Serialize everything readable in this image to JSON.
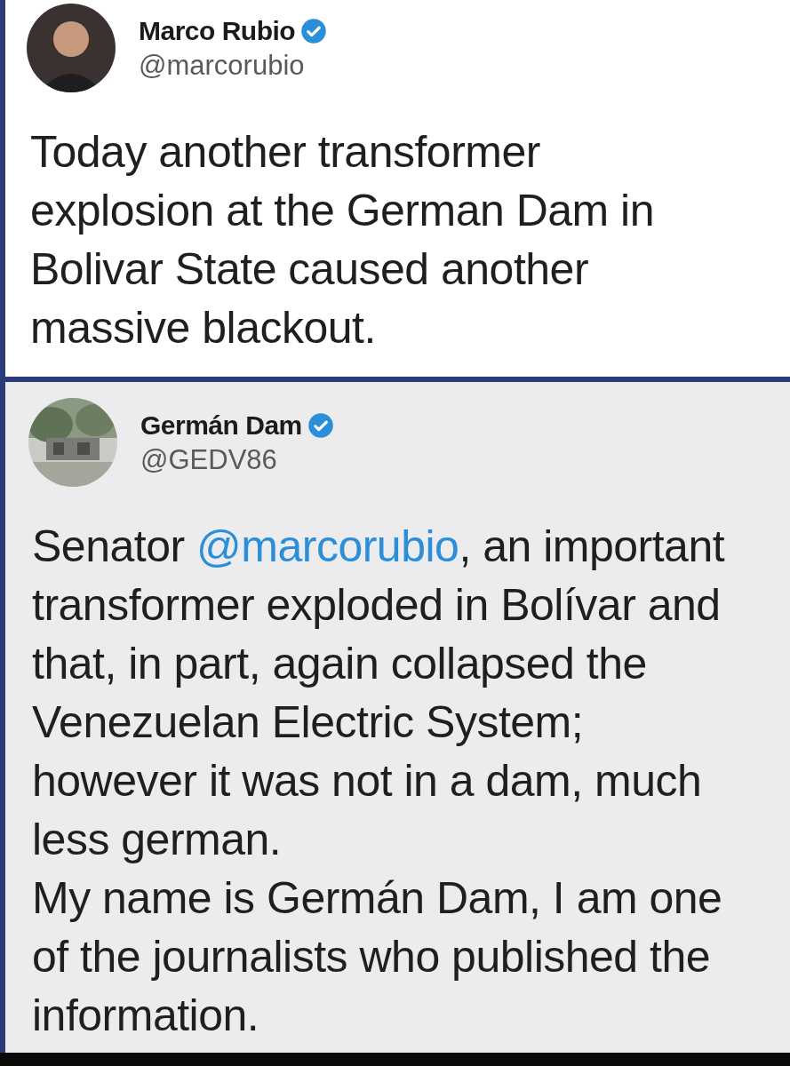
{
  "tweets": [
    {
      "author": {
        "name": "Marco Rubio",
        "handle": "@marcorubio",
        "verified": true,
        "avatar": {
          "kind": "silhouette"
        }
      },
      "body": [
        {
          "kind": "text",
          "text": "Today another transformer\nexplosion at the German Dam in\nBolivar State caused another\nmassive blackout."
        }
      ]
    },
    {
      "author": {
        "name": "Germán Dam",
        "handle": "@GEDV86",
        "verified": true
      },
      "body": [
        {
          "kind": "text",
          "text": "Senator "
        },
        {
          "kind": "mention",
          "text": "@marcorubio"
        },
        {
          "kind": "text",
          "text": ", an important\ntransformer exploded in Bolívar and\nthat, in part, again collapsed the\nVenezuelan Electric System;\nhowever it was not in a dam, much\nless german.\nMy name is Germán Dam, I am one\nof the journalists who published the\ninformation."
        }
      ]
    }
  ]
}
